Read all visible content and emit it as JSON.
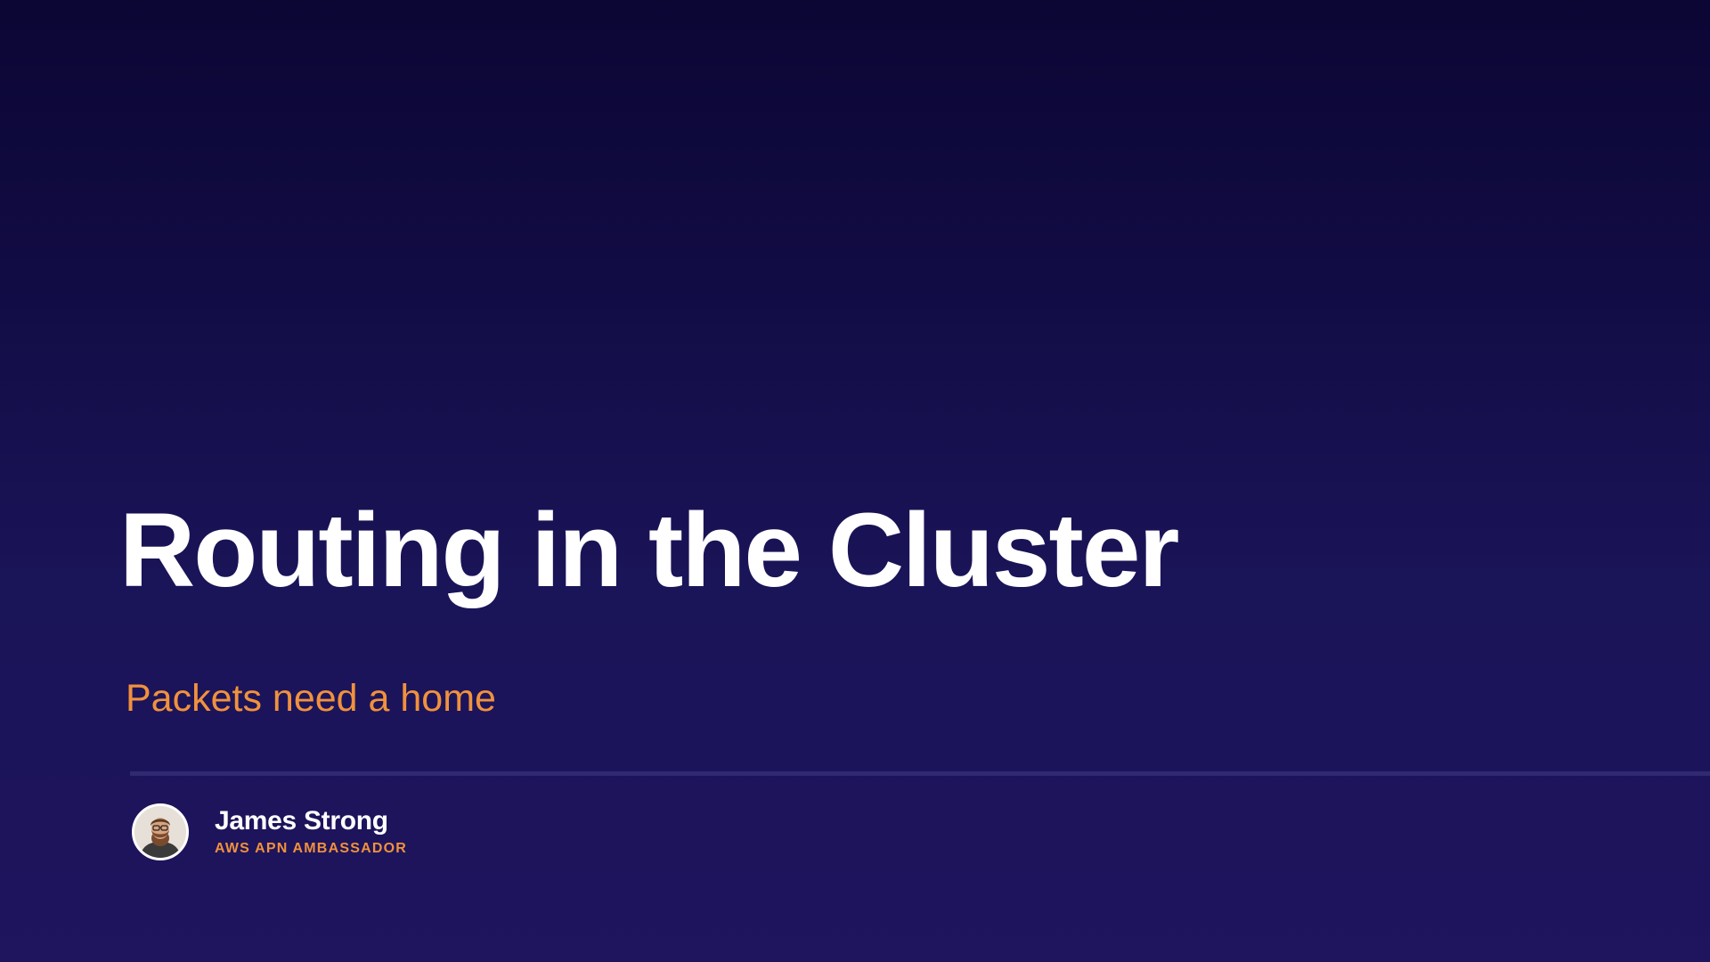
{
  "slide": {
    "title": "Routing in the Cluster",
    "subtitle": "Packets need a home",
    "presenter": {
      "name": "James Strong",
      "role": "AWS APN AMBASSADOR",
      "avatar_icon": "person-photo-icon"
    },
    "colors": {
      "background_top": "#0b0634",
      "background_bottom": "#1f145e",
      "title": "#ffffff",
      "accent": "#f0913d",
      "divider": "#2f2a72"
    }
  }
}
